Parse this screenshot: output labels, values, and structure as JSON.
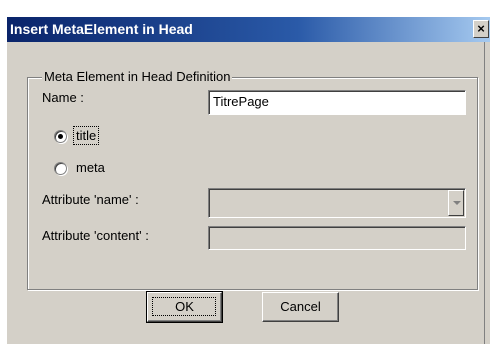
{
  "window": {
    "title": "Insert MetaElement in Head",
    "close_glyph": "×"
  },
  "group": {
    "legend": "Meta Element in Head Definition"
  },
  "form": {
    "name_label": "Name :",
    "name_value": "TitrePage",
    "radio_title_label": "title",
    "radio_meta_label": "meta",
    "selected_radio": "title",
    "attr_name_label": "Attribute 'name' :",
    "attr_name_value": "",
    "attr_content_label": "Attribute 'content' :",
    "attr_content_value": ""
  },
  "buttons": {
    "ok_label": "OK",
    "cancel_label": "Cancel"
  },
  "icons": {
    "close": "close-icon",
    "dropdown": "chevron-down-icon"
  },
  "colors": {
    "titlebar": "#0a246a",
    "dialog_bg": "#d4d0c8"
  }
}
